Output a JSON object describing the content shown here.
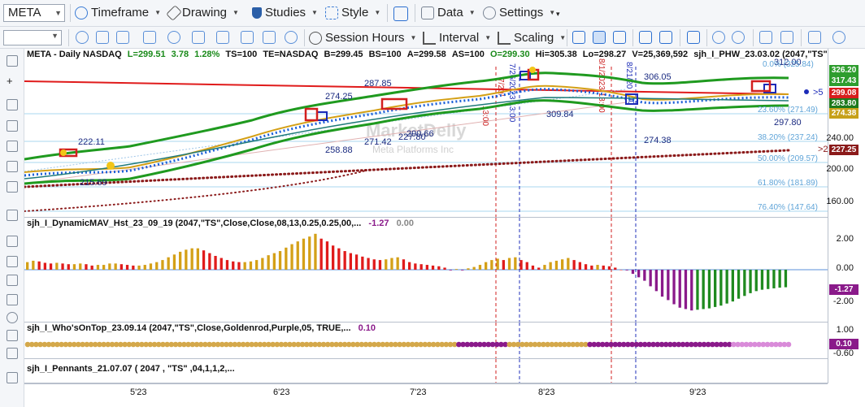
{
  "toolbar1": {
    "symbol": "META",
    "timeframe": "Timeframe",
    "drawing": "Drawing",
    "studies": "Studies",
    "style": "Style",
    "data": "Data",
    "settings": "Settings"
  },
  "toolbar2": {
    "session_hours": "Session Hours",
    "interval": "Interval",
    "scaling": "Scaling"
  },
  "price_pane": {
    "title": "META - Daily  NASDAQ",
    "L": "L=299.51",
    "chg": "3.78",
    "pct": "1.28%",
    "ts": "TS=100",
    "te": "TE=NASDAQ",
    "b": "B=299.45",
    "bs": "BS=100",
    "a": "A=299.58",
    "as": "AS=100",
    "o": "O=299.30",
    "hi": "Hi=305.38",
    "lo": "Lo=298.27",
    "v": "V=25,369,592",
    "study": "sjh_I_PHW_23.03.02 (2047,\"TS\",0.00 ...",
    "watermark1": "MarketDelly",
    "watermark2": "Meta Platforms Inc",
    "price_labels": [
      "222.11",
      "215.69",
      "274.25",
      "258.88",
      "287.85",
      "271.42",
      "227.80",
      "306.05",
      "309.84",
      "274.38",
      "297.80",
      "312.00",
      "290.66"
    ],
    "fib_labels": [
      "0.0% (325.84)",
      "23.60% (271.49)",
      "38.20% (237.24)",
      "50.00% (209.57)",
      "61.80% (181.89)",
      "76.40% (147.64)"
    ],
    "vline_labels": [
      "7/20/",
      "13:00",
      "7/26/2023 13:00",
      "8/1/2023 13:00",
      "8/21/20",
      "00"
    ],
    "axis_ticks": [
      "240.00",
      "220.00",
      "200.00",
      "180.00",
      "160.00"
    ],
    "tags": [
      {
        "text": "326.20",
        "color": "#2e9d2e"
      },
      {
        "text": "317.43",
        "color": "#2e9d2e"
      },
      {
        "text": "299.08",
        "color": "#d81e1e"
      },
      {
        "text": "283.80",
        "color": "#1d7a1d"
      },
      {
        "text": "274.38",
        "color": "#c7a11a"
      },
      {
        "text": "227.25",
        "color": "#8b1a1a"
      }
    ],
    "marker1": ">5",
    "marker2": ">2",
    "marker3": ">2"
  },
  "hist_pane": {
    "title": "sjh_I_DynamicMAV_Hst_23_09_19 (2047,\"TS\",Close,Close,08,13,0.25,0.25,00,...",
    "v1": "-1.27",
    "v2": "0.00",
    "axis_ticks": [
      "2.00",
      "0.00",
      "-2.00"
    ],
    "tag": "-1.27",
    "chart_data": {
      "type": "bar",
      "values": [
        0.55,
        0.65,
        0.6,
        0.5,
        0.45,
        0.5,
        0.45,
        0.4,
        0.4,
        0.45,
        0.4,
        0.3,
        0.35,
        0.35,
        0.45,
        0.45,
        0.4,
        0.35,
        0.3,
        0.3,
        0.35,
        0.45,
        0.55,
        0.7,
        0.9,
        1.1,
        1.3,
        1.45,
        1.55,
        1.55,
        1.4,
        1.2,
        1.0,
        0.85,
        0.7,
        0.6,
        0.55,
        0.55,
        0.6,
        0.7,
        0.85,
        1.05,
        1.2,
        1.35,
        1.6,
        1.85,
        2.05,
        2.25,
        2.4,
        2.6,
        2.25,
        2.05,
        1.75,
        1.55,
        1.35,
        1.2,
        1.1,
        0.95,
        0.85,
        0.75,
        0.7,
        0.75,
        0.85,
        0.9,
        0.75,
        0.55,
        0.45,
        0.4,
        0.35,
        0.3,
        0.25,
        0.15,
        -0.05,
        0.05,
        -0.05,
        0.1,
        0.2,
        0.35,
        0.55,
        0.7,
        0.8,
        0.7,
        0.85,
        0.9,
        0.7,
        0.55,
        0.3,
        0.15,
        0.35,
        0.55,
        0.65,
        0.75,
        0.85,
        0.7,
        0.55,
        0.4,
        0.3,
        0.35,
        0.3,
        0.25,
        0.15,
        0.0,
        -0.05,
        -0.3,
        -0.55,
        -0.8,
        -1.2,
        -1.55,
        -1.95,
        -2.2,
        -2.5,
        -2.75,
        -2.85,
        -2.95,
        -2.9,
        -2.85,
        -2.8,
        -2.7,
        -2.6,
        -2.45,
        -2.3,
        -2.1,
        -1.9,
        -1.7,
        -1.55,
        -1.45,
        -1.4,
        -1.35,
        -1.3,
        -1.27
      ]
    }
  },
  "who_pane": {
    "title": "sjh_I_Who'sOnTop_23.09.14 (2047,\"TS\",Close,Goldenrod,Purple,05,  TRUE,...",
    "v1": "0.10",
    "axis_ticks": [
      "1.00",
      "-0.60"
    ],
    "tag": "0.10",
    "chart_data": {
      "type": "scatter",
      "values": [
        "G",
        "G",
        "G",
        "G",
        "G",
        "G",
        "G",
        "G",
        "G",
        "G",
        "G",
        "G",
        "G",
        "G",
        "G",
        "G",
        "G",
        "G",
        "G",
        "G",
        "G",
        "G",
        "G",
        "G",
        "G",
        "G",
        "G",
        "G",
        "G",
        "G",
        "G",
        "G",
        "G",
        "G",
        "G",
        "G",
        "G",
        "G",
        "G",
        "G",
        "G",
        "G",
        "G",
        "G",
        "G",
        "G",
        "G",
        "G",
        "G",
        "G",
        "G",
        "G",
        "G",
        "G",
        "G",
        "G",
        "G",
        "G",
        "G",
        "G",
        "G",
        "G",
        "G",
        "G",
        "G",
        "G",
        "G",
        "G",
        "G",
        "G",
        "G",
        "G",
        "G",
        "G",
        "G",
        "G",
        "G",
        "G",
        "G",
        "G",
        "G",
        "G",
        "G",
        "G",
        "G",
        "G",
        "G",
        "G",
        "G",
        "G",
        "G",
        "G",
        "G",
        "G",
        "G",
        "G",
        "G",
        "G",
        "G",
        "G",
        "G",
        "G",
        "P",
        "P",
        "P",
        "P",
        "P",
        "P",
        "P",
        "P",
        "P",
        "P",
        "P",
        "P",
        "G",
        "G",
        "G",
        "G",
        "G",
        "G",
        "G",
        "G",
        "G",
        "G",
        "G",
        "G",
        "G",
        "G",
        "G",
        "G",
        "G",
        "G",
        "G",
        "P",
        "P",
        "P",
        "P",
        "P",
        "P",
        "P",
        "P",
        "P",
        "P",
        "P",
        "P",
        "P",
        "P",
        "P",
        "P",
        "P",
        "P",
        "P",
        "P",
        "P",
        "P",
        "P",
        "P",
        "P",
        "P",
        "P",
        "P",
        "P",
        "P",
        "P",
        "P",
        "P",
        "P",
        "L",
        "L",
        "L",
        "L",
        "L",
        "L",
        "L",
        "L",
        "L",
        "L",
        "L",
        "L",
        "L",
        "L"
      ]
    }
  },
  "pennant_pane": {
    "title": "sjh_I_Pennants_21.07.07 (  2047 ,  \"TS\" ,04,1,1,2,..."
  },
  "time_axis": [
    "5'23",
    "6'23",
    "7'23",
    "8'23",
    "9'23"
  ]
}
